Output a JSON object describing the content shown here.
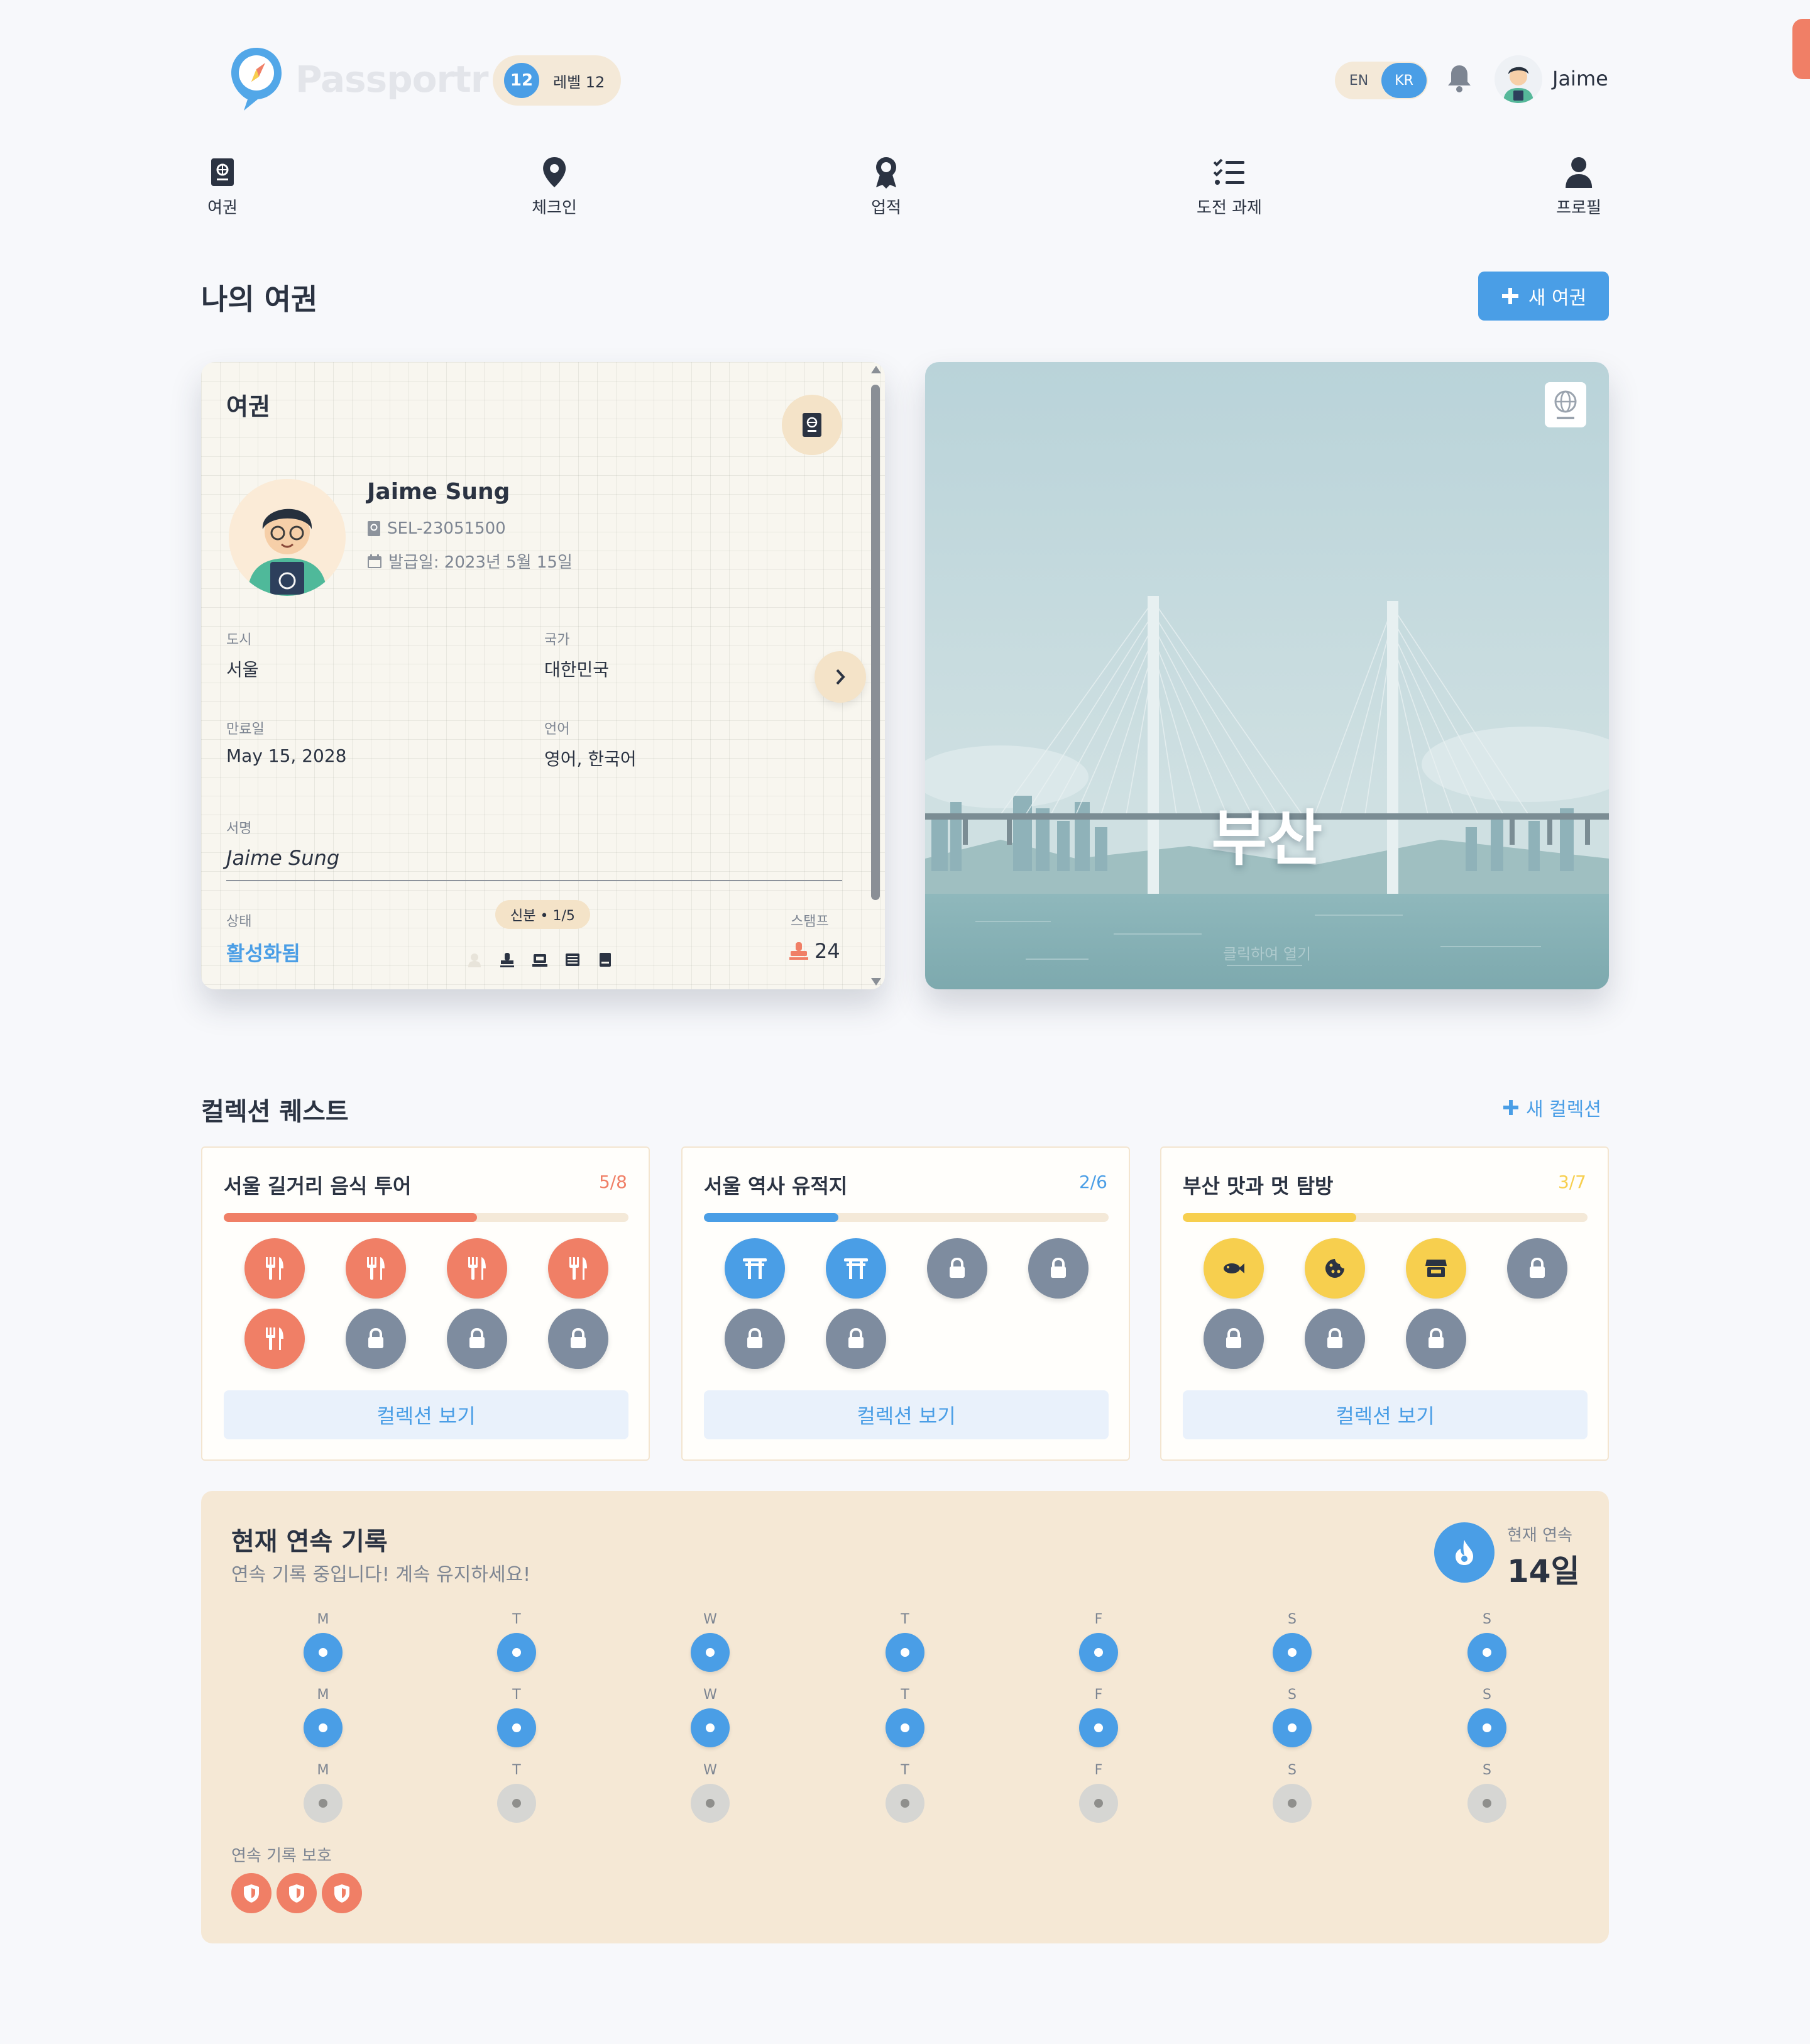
{
  "header": {
    "app_name": "Passportr",
    "level_number": "12",
    "level_label": "레벨 12",
    "lang_options": [
      "EN",
      "KR"
    ],
    "active_lang": "KR",
    "user_name": "Jaime"
  },
  "nav": {
    "items": [
      {
        "label": "여권",
        "icon": "passport-icon"
      },
      {
        "label": "체크인",
        "icon": "map-pin-icon"
      },
      {
        "label": "업적",
        "icon": "award-icon"
      },
      {
        "label": "도전 과제",
        "icon": "checklist-icon"
      },
      {
        "label": "프로필",
        "icon": "user-icon"
      }
    ]
  },
  "my_passport": {
    "title": "나의 여권",
    "new_button": "새 여권"
  },
  "passport": {
    "title": "여권",
    "name": "Jaime Sung",
    "passport_id": "SEL-23051500",
    "issue_date": "발급일: 2023년 5월 15일",
    "city_label": "도시",
    "city_value": "서울",
    "country_label": "국가",
    "country_value": "대한민국",
    "expiry_label": "만료일",
    "expiry_value": "May 15, 2028",
    "language_label": "언어",
    "language_value": "영어, 한국어",
    "signature_label": "서명",
    "signature_value": "Jaime Sung",
    "status_label": "상태",
    "status_value": "활성화됨",
    "page_indicator": "신분 • 1/5",
    "stamps_label": "스탬프",
    "stamps_value": "24"
  },
  "city_card": {
    "city_name": "부산",
    "hint": "클릭하여 열기"
  },
  "collections": {
    "title": "컬렉션 퀘스트",
    "new_button": "새 컬렉션",
    "view_label": "컬렉션 보기",
    "items": [
      {
        "title": "서울 길거리 음식 투어",
        "progress_text": "5/8",
        "progress": 0.625,
        "color": "#f07f66",
        "icons": [
          "utensils-icon",
          "utensils-icon",
          "utensils-icon",
          "utensils-icon",
          "utensils-icon",
          "lock-icon",
          "lock-icon",
          "lock-icon"
        ]
      },
      {
        "title": "서울 역사 유적지",
        "progress_text": "2/6",
        "progress": 0.333,
        "color": "#4a9ee6",
        "icons": [
          "torii-gate-icon",
          "torii-gate-icon",
          "lock-icon",
          "lock-icon",
          "lock-icon",
          "lock-icon"
        ]
      },
      {
        "title": "부산 맛과 멋 탐방",
        "progress_text": "3/7",
        "progress": 0.429,
        "color": "#f7cf4e",
        "icons": [
          "fish-icon",
          "cookie-icon",
          "store-icon",
          "lock-icon",
          "lock-icon",
          "lock-icon",
          "lock-icon"
        ]
      }
    ]
  },
  "streak": {
    "title": "현재 연속 기록",
    "subtitle": "연속 기록 중입니다! 계속 유지하세요!",
    "current_label": "현재 연속",
    "current_value": "14일",
    "day_letters": [
      "M",
      "T",
      "W",
      "T",
      "F",
      "S",
      "S"
    ],
    "weeks": [
      [
        true,
        true,
        true,
        true,
        true,
        true,
        true
      ],
      [
        true,
        true,
        true,
        true,
        true,
        true,
        true
      ],
      [
        false,
        false,
        false,
        false,
        false,
        false,
        false
      ]
    ],
    "protection_label": "연속 기록 보호",
    "shields": 3
  },
  "colors": {
    "accent": "#4a9ee6",
    "coral": "#f07f66",
    "yellow": "#f7cf4e",
    "locked": "#7e8c9f",
    "cream": "#f5e8d5"
  }
}
